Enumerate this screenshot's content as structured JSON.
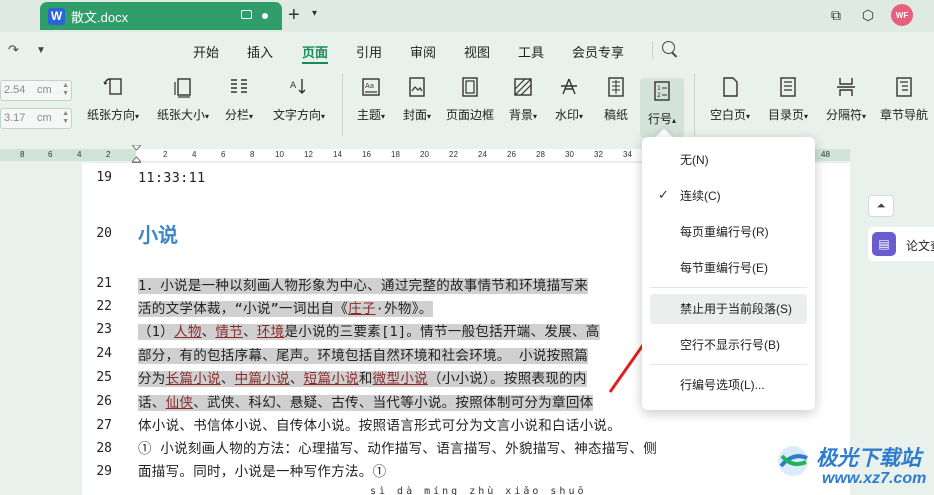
{
  "titlebar": {
    "doc_name": "散文.docx",
    "app_badge": "W",
    "avatar_text": "WF"
  },
  "menubar": {
    "items": [
      "开始",
      "插入",
      "页面",
      "引用",
      "审阅",
      "视图",
      "工具",
      "会员专享"
    ],
    "active": "页面"
  },
  "ribbon": {
    "margin_top_value": "2.54",
    "margin_bottom_value": "3.17",
    "unit": "cm",
    "buttons": {
      "paper_orientation": "纸张方向",
      "paper_size": "纸张大小",
      "columns": "分栏",
      "text_direction": "文字方向",
      "theme": "主题",
      "cover": "封面",
      "page_border": "页面边框",
      "background": "背景",
      "watermark": "水印",
      "draft": "稿纸",
      "line_numbers": "行号",
      "blank_page": "空白页",
      "toc_page": "目录页",
      "separator": "分隔符",
      "chapter_nav": "章节导航"
    }
  },
  "ruler": {
    "left_numbers": [
      "8",
      "6",
      "4",
      "2"
    ],
    "numbers": [
      "2",
      "4",
      "6",
      "8",
      "10",
      "12",
      "14",
      "16",
      "18",
      "20",
      "22",
      "24",
      "26",
      "28",
      "30",
      "32",
      "34"
    ],
    "right_number": "48"
  },
  "document": {
    "lines": [
      {
        "no": "19",
        "text": "11:33:11"
      },
      {
        "no": "20",
        "text": "小说"
      },
      {
        "no": "21",
        "text": "1．小说是一种以刻画人物形象为中心、通过完整的故事情节和环境描写来"
      },
      {
        "no": "22",
        "text_a": "活的文学体裁，“小说”一词出自《",
        "link": "庄子",
        "text_b": "·外物》。"
      },
      {
        "no": "23",
        "text_a": "（1）",
        "link1": "人物",
        "sep1": "、",
        "link2": "情节",
        "sep2": "、",
        "link3": "环境",
        "text_b": "是小说的三要素[1]。情节一般包括开端、发展、高"
      },
      {
        "no": "24",
        "text": "部分，有的包括序幕、尾声。环境包括自然环境和社会环境。 小说按照篇"
      },
      {
        "no": "25",
        "text_a": "分为",
        "link1": "长篇小说",
        "sep1": "、",
        "link2": "中篇小说",
        "sep2": "、",
        "link3": "短篇小说",
        "sep3": "和",
        "link4": "微型小说",
        "text_b": "（小小说）。按照表现的内"
      },
      {
        "no": "26",
        "text_a": "话、",
        "link": "仙侠",
        "text_b": "、武侠、科幻、悬疑、古传、当代等小说。按照体制可分为章回体"
      },
      {
        "no": "27",
        "text": "体小说、书信体小说、自传体小说。按照语言形式可分为文言小说和白话小说。"
      },
      {
        "no": "28",
        "text": "① 小说刻画人物的方法：心理描写、动作描写、语言描写、外貌描写、神态描写、侧"
      },
      {
        "no": "29",
        "text": "面描写。同时，小说是一种写作方法。①"
      }
    ],
    "pinyin": "sì  dà  míng  zhù  xiǎo  shuō"
  },
  "dropdown": {
    "items": [
      "无(N)",
      "连续(C)",
      "每页重编行号(R)",
      "每节重编行号(E)",
      "禁止用于当前段落(S)",
      "空行不显示行号(B)",
      "行编号选项(L)..."
    ],
    "checked_index": 1,
    "highlight_index": 4
  },
  "right_panel": {
    "item_label": "论文查重"
  },
  "watermark": {
    "title": "极光下载站",
    "url": "www.xz7.com"
  },
  "colors": {
    "accent": "#1a8a55",
    "tab": "#2f9e6b",
    "heading": "#3b86c6",
    "arrow": "#e02020"
  }
}
